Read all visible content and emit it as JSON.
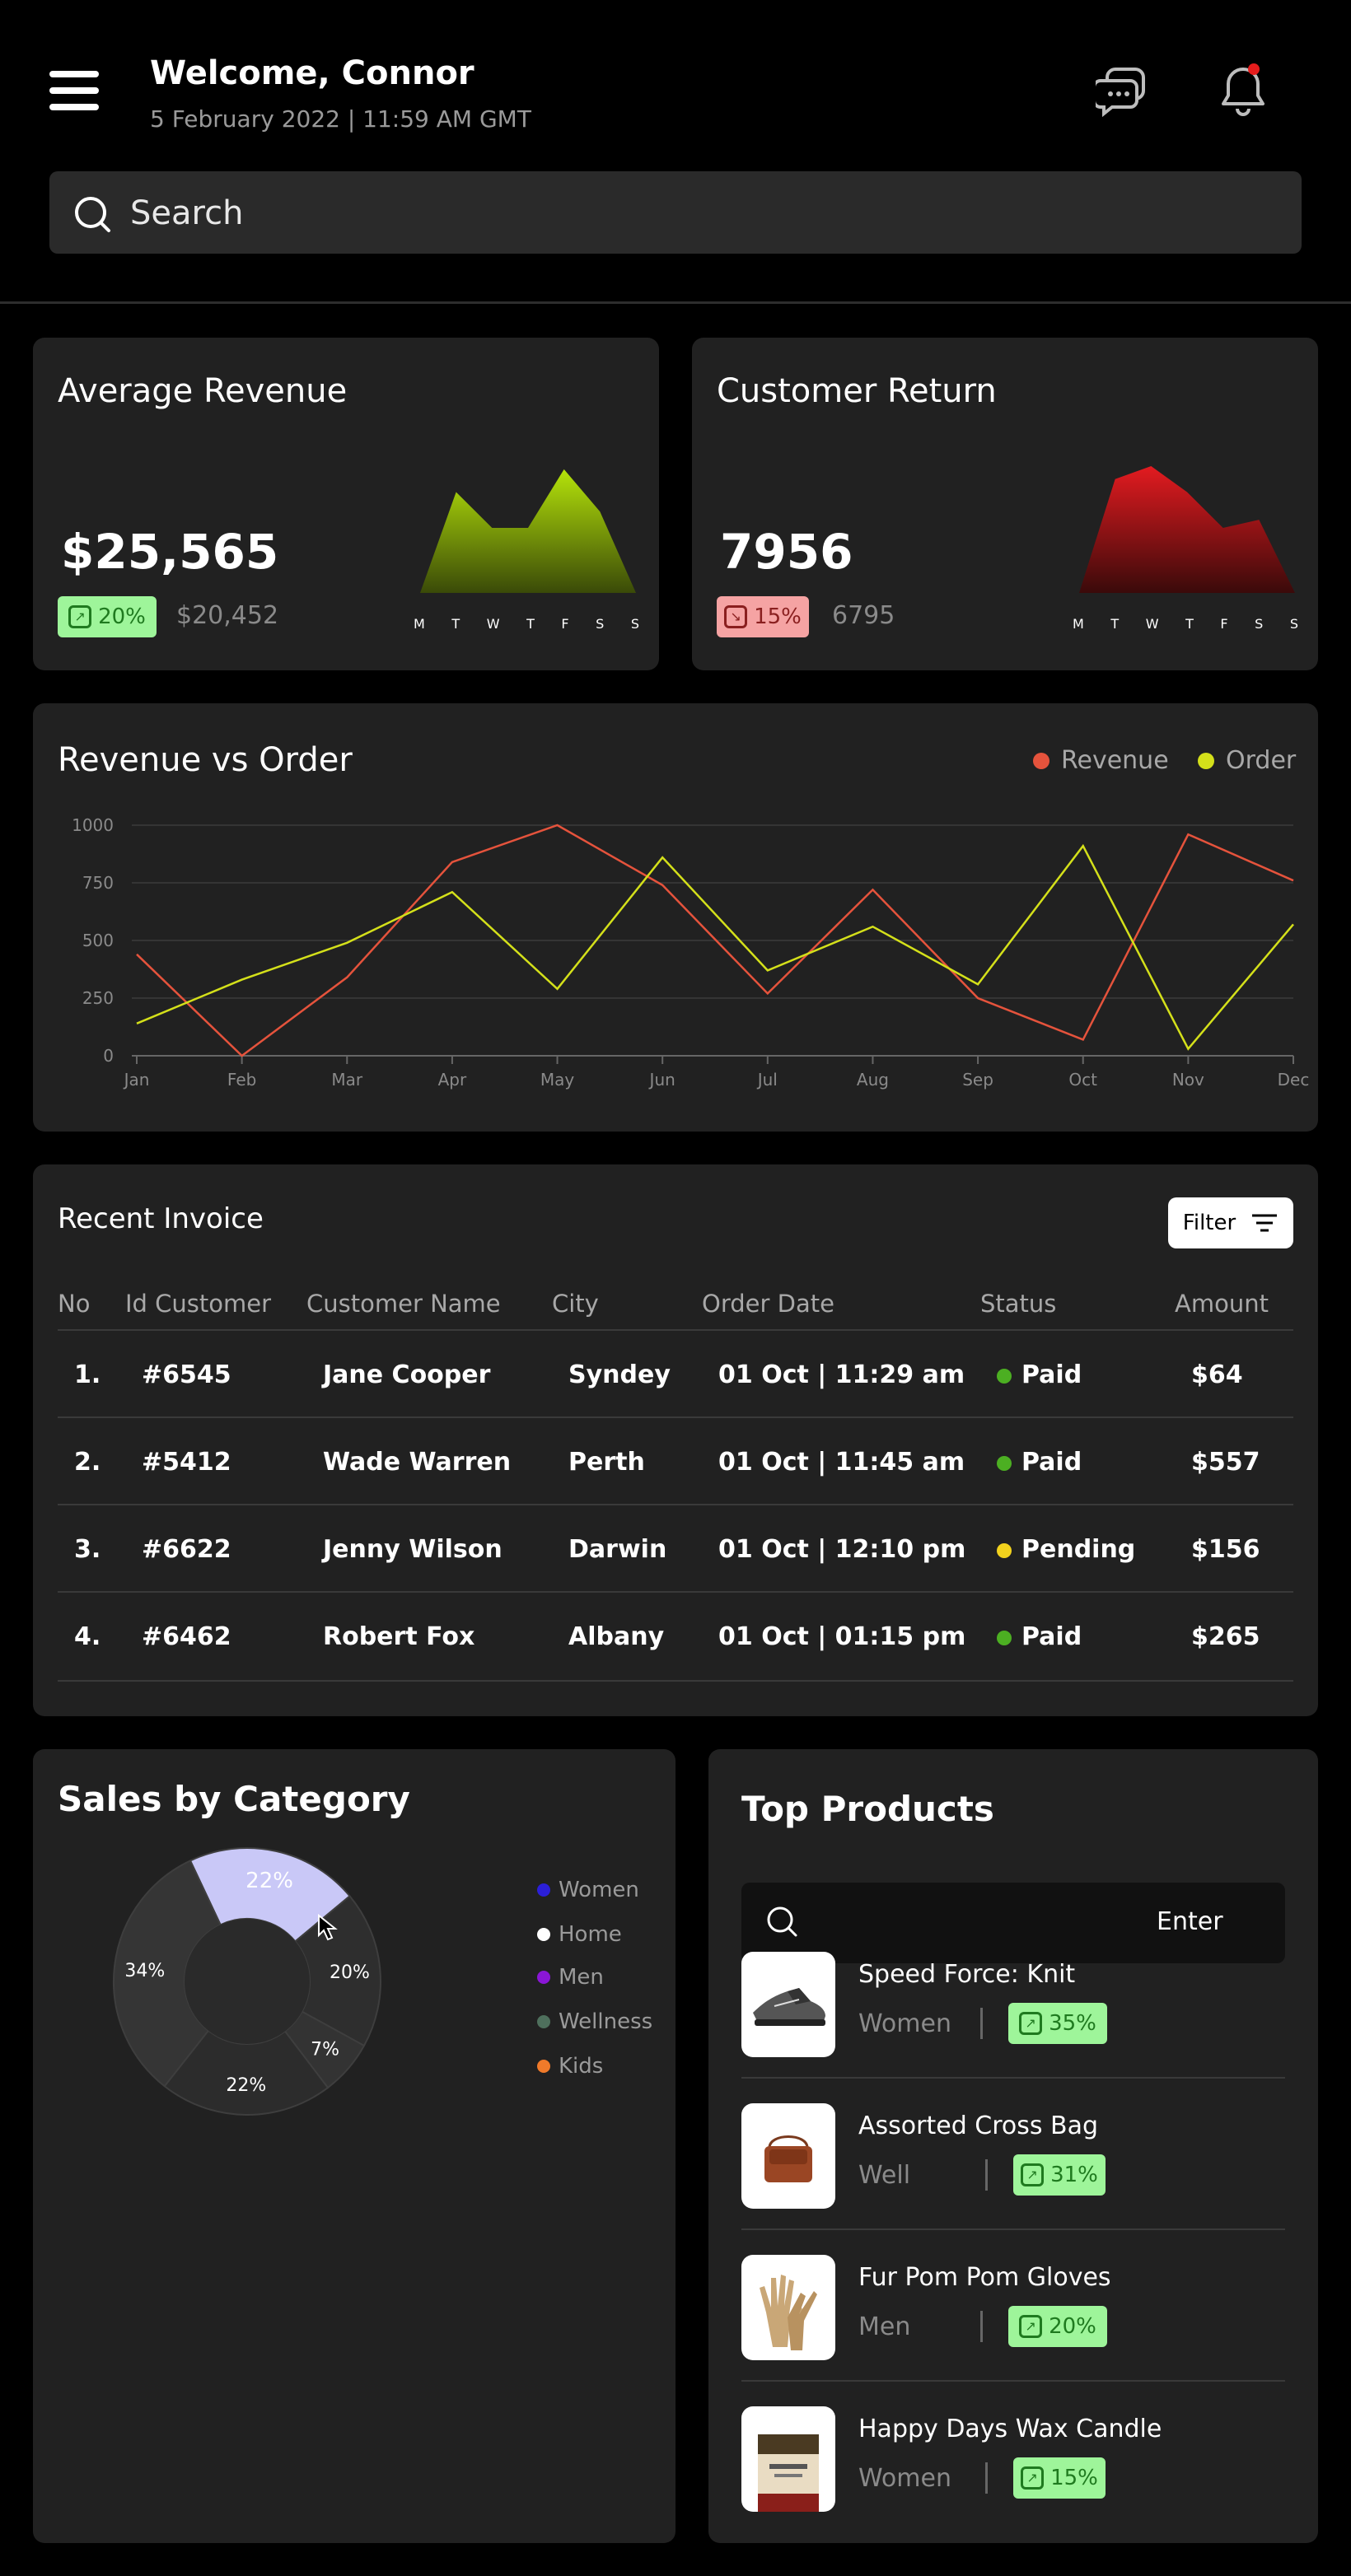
{
  "header": {
    "welcome": "Welcome, Connor",
    "datetime": "5 February 2022 | 11:59 AM GMT",
    "notification_color": "#e51c1c"
  },
  "search": {
    "placeholder": "Search"
  },
  "average_revenue": {
    "title": "Average Revenue",
    "value": "$25,565",
    "change": "20%",
    "previous": "$20,452",
    "days": [
      "M",
      "T",
      "W",
      "T",
      "F",
      "S",
      "S"
    ],
    "weekly_values": [
      0,
      62,
      40,
      40,
      76,
      50,
      0
    ],
    "color": "#a8d10a"
  },
  "customer_return": {
    "title": "Customer Return",
    "value": "7956",
    "change": "15%",
    "previous": "6795",
    "days": [
      "M",
      "T",
      "W",
      "T",
      "F",
      "S",
      "S"
    ],
    "weekly_values": [
      0,
      70,
      78,
      62,
      40,
      45,
      0
    ],
    "color": "#d9191e"
  },
  "revenue_vs_order": {
    "title": "Revenue vs Order",
    "legend": [
      {
        "label": "Revenue",
        "color": "#e5533c"
      },
      {
        "label": "Order",
        "color": "#d4e01a"
      }
    ]
  },
  "chart_data": {
    "type": "line",
    "title": "Revenue vs Order",
    "categories": [
      "Jan",
      "Feb",
      "Mar",
      "Apr",
      "May",
      "Jun",
      "Jul",
      "Aug",
      "Sep",
      "Oct",
      "Nov",
      "Dec"
    ],
    "yticks": [
      0,
      250,
      500,
      750,
      1000
    ],
    "ylim": [
      0,
      1000
    ],
    "series": [
      {
        "name": "Revenue",
        "color": "#e5533c",
        "values": [
          440,
          0,
          340,
          840,
          1000,
          740,
          270,
          720,
          250,
          70,
          960,
          760
        ]
      },
      {
        "name": "Order",
        "color": "#d4e01a",
        "values": [
          140,
          330,
          490,
          710,
          290,
          860,
          370,
          560,
          310,
          910,
          30,
          570
        ]
      }
    ]
  },
  "invoice": {
    "title": "Recent Invoice",
    "filter_label": "Filter",
    "columns": [
      "No",
      "Id Customer",
      "Customer Name",
      "City",
      "Order Date",
      "Status",
      "Amount"
    ],
    "rows": [
      {
        "no": "1.",
        "id": "#6545",
        "name": "Jane Cooper",
        "city": "Syndey",
        "date": "01 Oct | 11:29 am",
        "status": "Paid",
        "status_color": "#4caf22",
        "amount": "$64"
      },
      {
        "no": "2.",
        "id": "#5412",
        "name": "Wade Warren",
        "city": "Perth",
        "date": "01 Oct | 11:45 am",
        "status": "Paid",
        "status_color": "#4caf22",
        "amount": "$557"
      },
      {
        "no": "3.",
        "id": "#6622",
        "name": "Jenny Wilson",
        "city": "Darwin",
        "date": "01 Oct | 12:10 pm",
        "status": "Pending",
        "status_color": "#f2d21d",
        "amount": "$156"
      },
      {
        "no": "4.",
        "id": "#6462",
        "name": "Robert Fox",
        "city": "Albany",
        "date": "01 Oct | 01:15 pm",
        "status": "Paid",
        "status_color": "#4caf22",
        "amount": "$265"
      }
    ]
  },
  "sales_by_category": {
    "title": "Sales by Category",
    "slices": [
      {
        "label": "22%",
        "value": 22,
        "color": "#c9c8f7"
      },
      {
        "label": "20%",
        "value": 20,
        "color": "#2e2e2e"
      },
      {
        "label": "7%",
        "value": 7,
        "color": "#333333"
      },
      {
        "label": "22%",
        "value": 22,
        "color": "#2c2c2c"
      },
      {
        "label": "34%",
        "value": 34,
        "color": "#353535"
      }
    ],
    "legend": [
      {
        "label": "Women",
        "color": "#2b1fd8"
      },
      {
        "label": "Home",
        "color": "#ffffff"
      },
      {
        "label": "Men",
        "color": "#8a16d6"
      },
      {
        "label": "Wellness",
        "color": "#4e6f5c"
      },
      {
        "label": "Kids",
        "color": "#f07a2a"
      }
    ]
  },
  "top_products": {
    "title": "Top Products",
    "search_button": "Enter",
    "items": [
      {
        "name": "Speed Force: Knit",
        "category": "Women",
        "growth": "35%",
        "thumb": "sneaker-image"
      },
      {
        "name": "Assorted Cross Bag",
        "category": "Well",
        "growth": "31%",
        "thumb": "bag-image"
      },
      {
        "name": "Fur Pom Pom Gloves",
        "category": "Men",
        "growth": "20%",
        "thumb": "gloves-image"
      },
      {
        "name": "Happy Days Wax Candle",
        "category": "Women",
        "growth": "15%",
        "thumb": "candle-image"
      }
    ]
  }
}
